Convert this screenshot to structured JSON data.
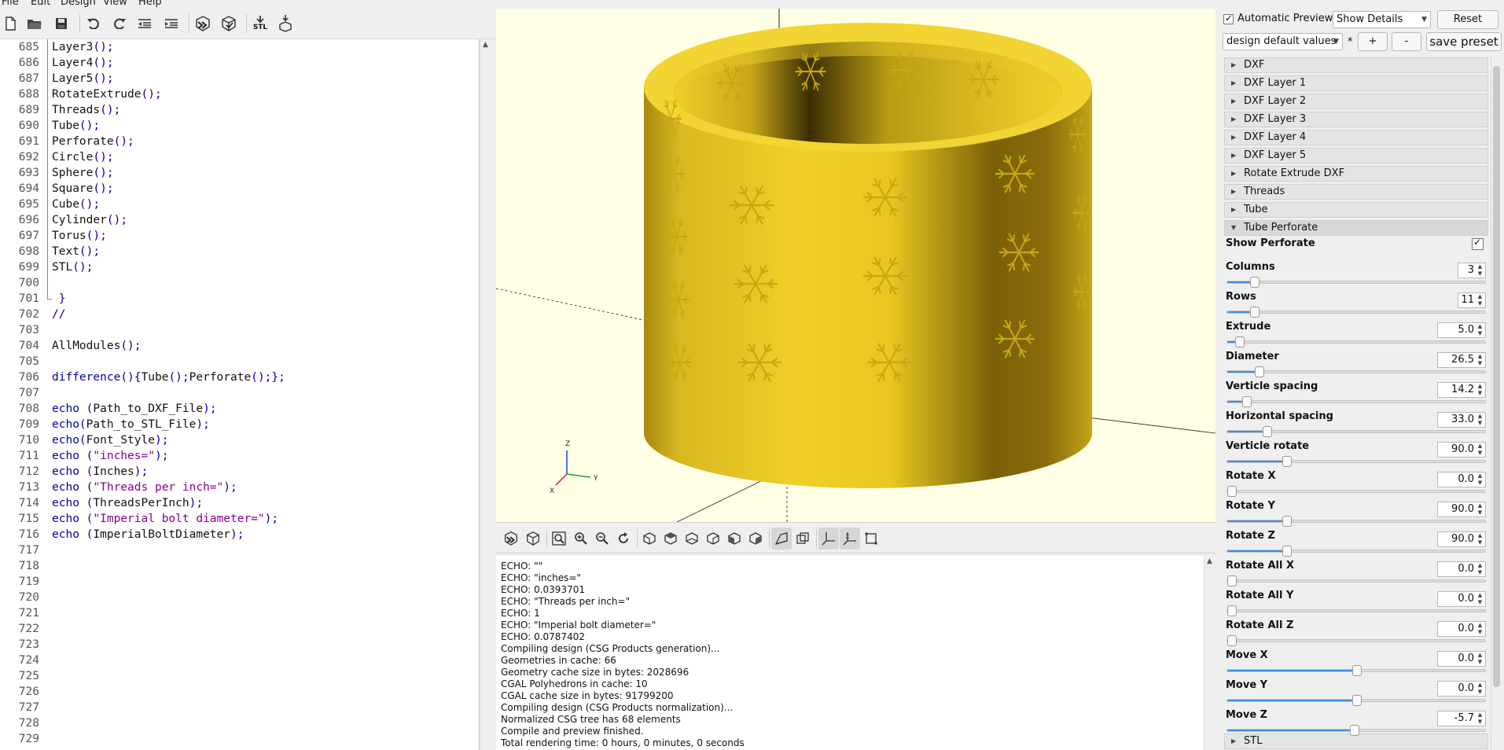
{
  "menu": [
    "File",
    "Edit",
    "Design",
    "View",
    "Help"
  ],
  "toolbar_icons": [
    "new-file-icon",
    "open-file-icon",
    "save-icon",
    "undo-icon",
    "redo-icon",
    "unindent-icon",
    "indent-icon",
    "preview-icon",
    "render-icon",
    "export-stl-icon",
    "send-to-printer-icon"
  ],
  "toolbar_stl_label": "STL",
  "editor": {
    "lines": [
      {
        "n": "685",
        "code": "Layer3();"
      },
      {
        "n": "686",
        "code": "Layer4();"
      },
      {
        "n": "687",
        "code": "Layer5();"
      },
      {
        "n": "688",
        "code": "RotateExtrude();"
      },
      {
        "n": "689",
        "code": "Threads();"
      },
      {
        "n": "690",
        "code": "Tube();"
      },
      {
        "n": "691",
        "code": "Perforate();"
      },
      {
        "n": "692",
        "code": "Circle();"
      },
      {
        "n": "693",
        "code": "Sphere();"
      },
      {
        "n": "694",
        "code": "Square();"
      },
      {
        "n": "695",
        "code": "Cube();"
      },
      {
        "n": "696",
        "code": "Cylinder();"
      },
      {
        "n": "697",
        "code": "Torus();"
      },
      {
        "n": "698",
        "code": "Text();"
      },
      {
        "n": "699",
        "code": "STL();"
      },
      {
        "n": "700",
        "code": ""
      },
      {
        "n": "701",
        "code": " }"
      },
      {
        "n": "702",
        "code": "//"
      },
      {
        "n": "703",
        "code": ""
      },
      {
        "n": "704",
        "code": "AllModules();"
      },
      {
        "n": "705",
        "code": ""
      },
      {
        "n": "706",
        "code": "difference(){Tube();Perforate();};"
      },
      {
        "n": "707",
        "code": ""
      },
      {
        "n": "708",
        "code": "echo (Path_to_DXF_File);"
      },
      {
        "n": "709",
        "code": "echo(Path_to_STL_File);"
      },
      {
        "n": "710",
        "code": "echo(Font_Style);"
      },
      {
        "n": "711",
        "code": "echo (\"inches=\");"
      },
      {
        "n": "712",
        "code": "echo (Inches);"
      },
      {
        "n": "713",
        "code": "echo (\"Threads per inch=\");"
      },
      {
        "n": "714",
        "code": "echo (ThreadsPerInch);"
      },
      {
        "n": "715",
        "code": "echo (\"Imperial bolt diameter=\");"
      },
      {
        "n": "716",
        "code": "echo (ImperialBoltDiameter);"
      },
      {
        "n": "717",
        "code": ""
      },
      {
        "n": "718",
        "code": ""
      },
      {
        "n": "719",
        "code": ""
      },
      {
        "n": "720",
        "code": ""
      },
      {
        "n": "721",
        "code": ""
      },
      {
        "n": "722",
        "code": ""
      },
      {
        "n": "723",
        "code": ""
      },
      {
        "n": "724",
        "code": ""
      },
      {
        "n": "725",
        "code": ""
      },
      {
        "n": "726",
        "code": ""
      },
      {
        "n": "727",
        "code": ""
      },
      {
        "n": "728",
        "code": ""
      },
      {
        "n": "729",
        "code": ""
      }
    ]
  },
  "viewport": {
    "axis_labels": {
      "x": "X",
      "y": "Y",
      "z": "Z"
    },
    "model_color": "#f0d030",
    "background": "#ffffe5"
  },
  "view_toolbar_icons": [
    "preview-icon",
    "render-icon",
    "view-all-icon",
    "zoom-in-icon",
    "zoom-out-icon",
    "reset-view-icon",
    "view-right-icon",
    "view-top-icon",
    "view-bottom-icon",
    "view-left-icon",
    "view-front-icon",
    "view-back-icon",
    "perspective-icon",
    "orthogonal-icon",
    "show-axes-icon",
    "show-scale-markers-icon",
    "show-edges-icon"
  ],
  "console": {
    "lines": [
      "ECHO: \"\"",
      "ECHO: \"inches=\"",
      "ECHO: 0.0393701",
      "ECHO: \"Threads per inch=\"",
      "ECHO: 1",
      "ECHO: \"Imperial bolt diameter=\"",
      "ECHO: 0.0787402",
      "Compiling design (CSG Products generation)...",
      "Geometries in cache: 66",
      "Geometry cache size in bytes: 2028696",
      "CGAL Polyhedrons in cache: 10",
      "CGAL cache size in bytes: 91799200",
      "Compiling design (CSG Products normalization)...",
      "Normalized CSG tree has 68 elements",
      "Compile and preview finished.",
      "Total rendering time: 0 hours, 0 minutes, 0 seconds"
    ]
  },
  "customizer": {
    "auto_preview_label": "Automatic Preview",
    "auto_preview_checked": true,
    "details_select": "Show Details",
    "reset_label": "Reset",
    "preset_select": "design default values",
    "preset_modified": "*",
    "add_label": "+",
    "remove_label": "-",
    "save_preset_label": "save preset",
    "collapsed_sections": [
      "DXF",
      "DXF Layer 1",
      "DXF Layer 2",
      "DXF Layer 3",
      "DXF Layer 4",
      "DXF Layer 5",
      "Rotate Extrude DXF",
      "Threads",
      "Tube"
    ],
    "open_section": "Tube Perforate",
    "show_perforate_label": "Show Perforate",
    "show_perforate_checked": true,
    "params": [
      {
        "label": "Columns",
        "value": "3",
        "pos": 0.09
      },
      {
        "label": "Rows",
        "value": "11",
        "pos": 0.09
      },
      {
        "label": "Extrude",
        "value": "5.0",
        "pos": 0.03
      },
      {
        "label": "Diameter",
        "value": "26.5",
        "pos": 0.11
      },
      {
        "label": "Verticle spacing",
        "value": "14.2",
        "pos": 0.06
      },
      {
        "label": "Horizontal spacing",
        "value": "33.0",
        "pos": 0.14
      },
      {
        "label": "Verticle rotate",
        "value": "90.0",
        "pos": 0.22
      },
      {
        "label": "Rotate X",
        "value": "0.0",
        "pos": 0.0
      },
      {
        "label": "Rotate Y",
        "value": "90.0",
        "pos": 0.22
      },
      {
        "label": "Rotate Z",
        "value": "90.0",
        "pos": 0.22
      },
      {
        "label": "Rotate All X",
        "value": "0.0",
        "pos": 0.0
      },
      {
        "label": "Rotate All Y",
        "value": "0.0",
        "pos": 0.0
      },
      {
        "label": "Rotate All Z",
        "value": "0.0",
        "pos": 0.0
      },
      {
        "label": "Move X",
        "value": "0.0",
        "pos": 0.5
      },
      {
        "label": "Move Y",
        "value": "0.0",
        "pos": 0.5
      },
      {
        "label": "Move Z",
        "value": "-5.7",
        "pos": 0.49
      }
    ],
    "bottom_section": "STL",
    "accent": "#3d8ee8"
  }
}
